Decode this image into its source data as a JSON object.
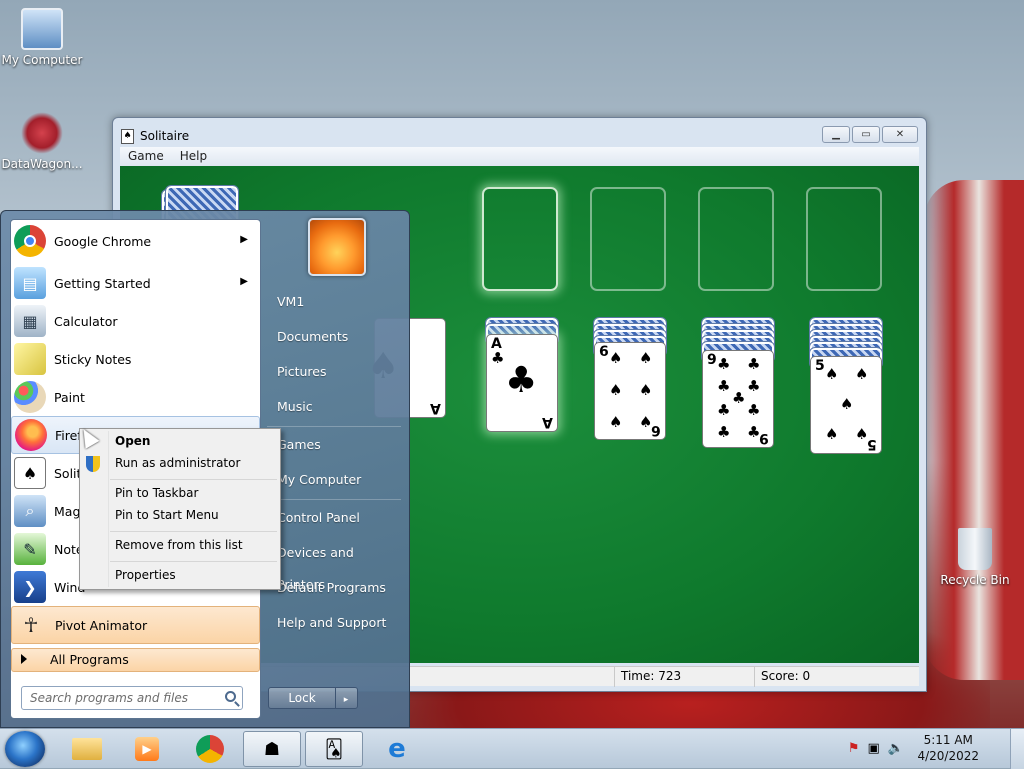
{
  "desktop": {
    "icons": [
      {
        "label": "My Computer",
        "icon": "computer-icon"
      },
      {
        "label": "DataWagon...",
        "icon": "datawagon-icon"
      },
      {
        "label": "Recycle Bin",
        "icon": "recycle-bin-icon"
      }
    ]
  },
  "solitaire": {
    "title": "Solitaire",
    "menu": [
      "Game",
      "Help"
    ],
    "status": {
      "time": "Time:  723",
      "score": "Score: 0"
    },
    "cards": {
      "c1_rank": "A",
      "c2_rank": "6",
      "c3_rank": "9",
      "c4_rank": "5",
      "partial_rank": "A",
      "club": "♣",
      "spade": "♠"
    }
  },
  "start_menu": {
    "programs": [
      {
        "label": "Google Chrome",
        "icon": "chrome-icon",
        "submenu": true
      },
      {
        "label": "Getting Started",
        "icon": "getting-started-icon",
        "submenu": true
      },
      {
        "label": "Calculator",
        "icon": "calculator-icon"
      },
      {
        "label": "Sticky Notes",
        "icon": "sticky-notes-icon"
      },
      {
        "label": "Paint",
        "icon": "paint-icon"
      },
      {
        "label": "Firefo",
        "icon": "firefox-icon"
      },
      {
        "label": "Solita",
        "icon": "solitaire-icon"
      },
      {
        "label": "Magn",
        "icon": "magnifier-icon"
      },
      {
        "label": "Notep",
        "icon": "notepad-icon"
      },
      {
        "label": "Wind",
        "icon": "powershell-icon"
      },
      {
        "label": "Pivot Animator",
        "icon": "pivot-animator-icon"
      }
    ],
    "all_programs": "All Programs",
    "search_placeholder": "Search programs and files",
    "right_items": [
      "VM1",
      "Documents",
      "Pictures",
      "Music",
      "Games",
      "My Computer",
      "Control Panel",
      "Devices and Printers",
      "Default Programs",
      "Help and Support"
    ],
    "right_items_visible": [
      "VM1",
      "Documents",
      "Pictures",
      "Music",
      "Games",
      "My Computer",
      "Control Panel",
      "Devices and Printers",
      "Default Programs",
      "Help and Support"
    ],
    "lock_label": "Lock",
    "lock_more": "▸"
  },
  "context_menu": {
    "items": [
      "Open",
      "Run as administrator",
      "Pin to Taskbar",
      "Pin to Start Menu",
      "Remove from this list",
      "Properties"
    ]
  },
  "taskbar": {
    "apps": [
      {
        "icon": "explorer-icon"
      },
      {
        "icon": "media-player-icon"
      },
      {
        "icon": "chrome-icon"
      },
      {
        "icon": "java-app-icon"
      },
      {
        "icon": "solitaire-icon"
      },
      {
        "icon": "internet-explorer-icon"
      }
    ],
    "time": "5:11 AM",
    "date": "4/20/2022"
  }
}
